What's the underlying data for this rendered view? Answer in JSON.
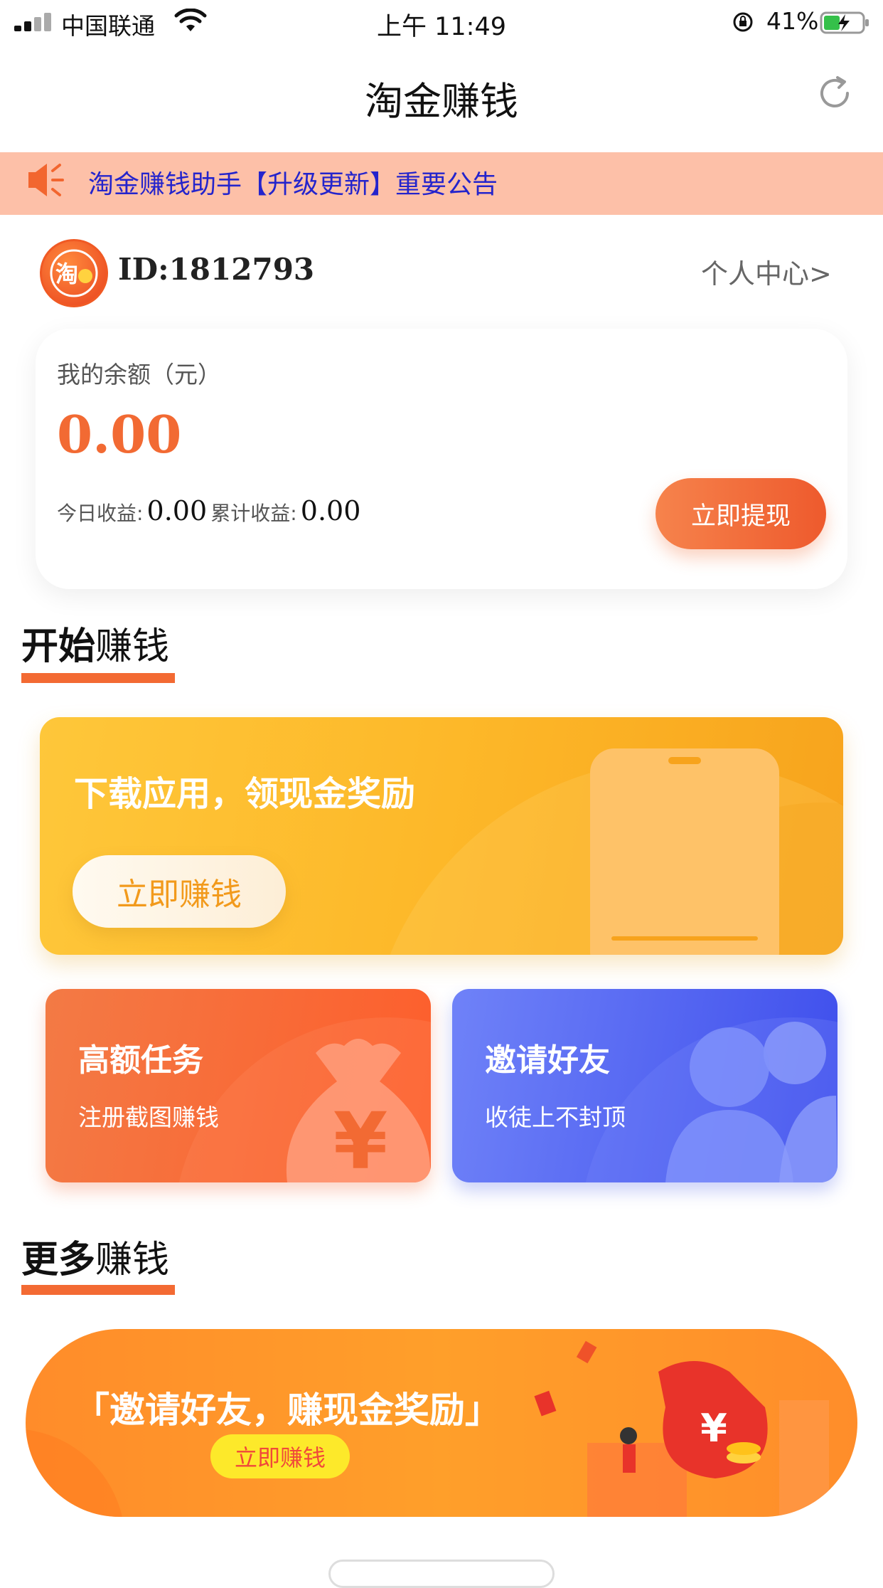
{
  "status_bar": {
    "carrier": "中国联通",
    "time": "上午 11:49",
    "battery": "41%"
  },
  "nav": {
    "title": "淘金赚钱"
  },
  "notice": {
    "text": "淘金赚钱助手【升级更新】重要公告"
  },
  "profile": {
    "id": "ID:1812793",
    "center_link": "个人中心>",
    "avatar_glyph": "淘"
  },
  "balance": {
    "label": "我的余额（元）",
    "value": "0.00",
    "today_label": "今日收益:",
    "today_value": "0.00",
    "total_label": "累计收益:",
    "total_value": "0.00",
    "withdraw_label": "立即提现"
  },
  "section_start": {
    "bold": "开始",
    "rest": "赚钱"
  },
  "download_card": {
    "title": "下载应用，领现金奖励",
    "button": "立即赚钱"
  },
  "task_cards": [
    {
      "title": "高额任务",
      "subtitle": "注册截图赚钱"
    },
    {
      "title": "邀请好友",
      "subtitle": "收徒上不封顶"
    }
  ],
  "section_more": {
    "bold": "更多",
    "rest": "赚钱"
  },
  "banner": {
    "text": "「邀请好友，赚现金奖励」",
    "button": "立即赚钱"
  },
  "colors": {
    "accent": "#f26a33",
    "notice_bg": "#fdc0a8",
    "notice_text": "#2424cc",
    "blue_card": "#4e5df0",
    "yellow_card": "#fdb829"
  }
}
